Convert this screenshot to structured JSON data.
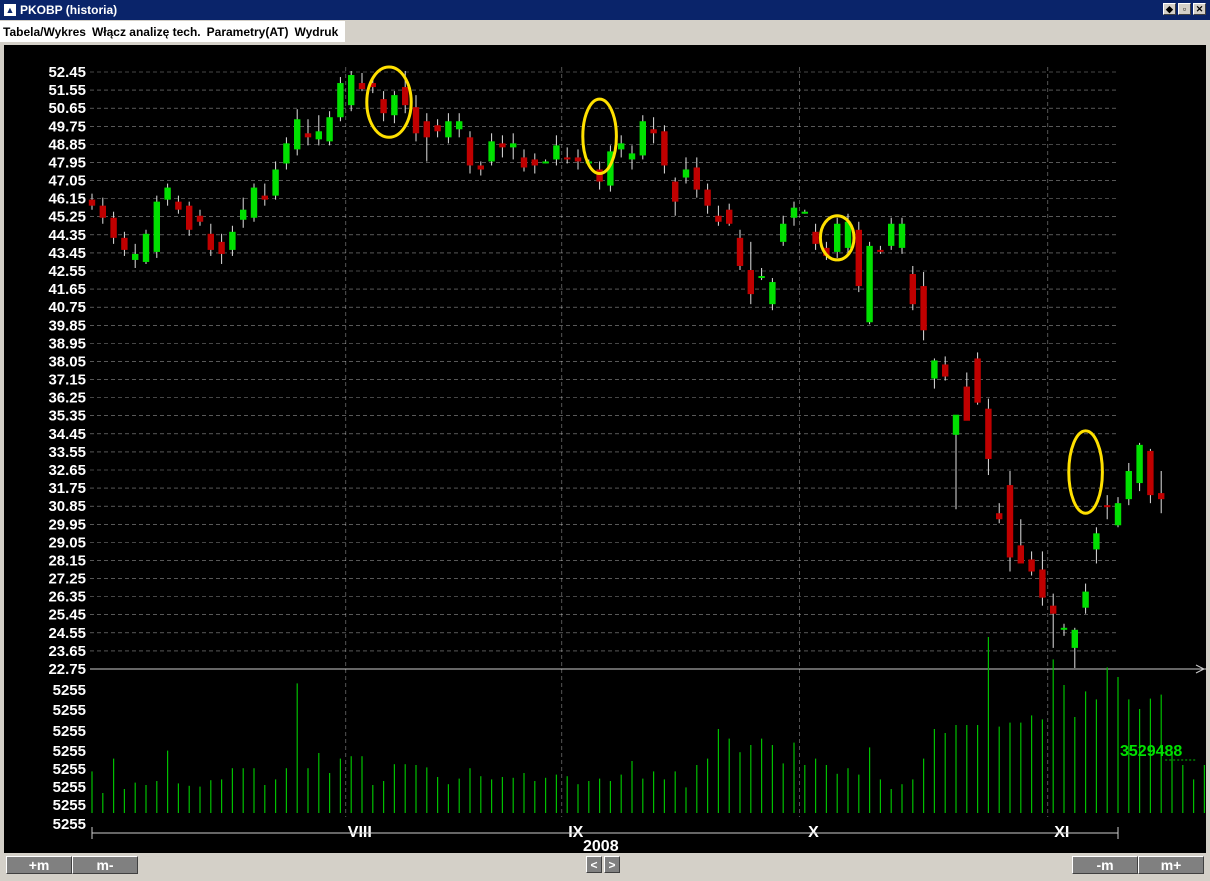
{
  "window": {
    "title": "PKOBP (historia)"
  },
  "menu": {
    "items": [
      "Tabela/Wykres",
      "Włącz analizę tech.",
      "Parametry(AT)",
      "Wydruk"
    ]
  },
  "toolbar": {
    "zoom_in": "+m",
    "zoom_out": "m-",
    "zoom_out_right": "-m",
    "zoom_in_right": "m+",
    "prev": "<",
    "next": ">"
  },
  "colors": {
    "up": "#00e000",
    "down": "#c00000",
    "annotation": "#ffe000",
    "volume": "#00c000",
    "grid": "#ffffff",
    "background": "#000000"
  },
  "chart_data": {
    "type": "candlestick",
    "year_label": "2008",
    "month_labels": [
      {
        "label": "VIII",
        "index": 24
      },
      {
        "label": "IX",
        "index": 44
      },
      {
        "label": "X",
        "index": 66
      },
      {
        "label": "XI",
        "index": 89
      }
    ],
    "price_ticks": [
      "52.45",
      "51.55",
      "50.65",
      "49.75",
      "48.85",
      "47.95",
      "47.05",
      "46.15",
      "45.25",
      "44.35",
      "43.45",
      "42.55",
      "41.65",
      "40.75",
      "39.85",
      "38.95",
      "38.05",
      "37.15",
      "36.25",
      "35.35",
      "34.45",
      "33.55",
      "32.65",
      "31.75",
      "30.85",
      "29.95",
      "29.05",
      "28.15",
      "27.25",
      "26.35",
      "25.45",
      "24.55",
      "23.65",
      "22.75"
    ],
    "ylim": [
      22.75,
      52.45
    ],
    "volume_ticks": [
      "5255",
      "5255",
      "5255",
      "5255",
      "5255",
      "5255",
      "5255",
      "5255"
    ],
    "last_volume": "3529488",
    "candles": [
      [
        46.1,
        46.4,
        45.6,
        45.8
      ],
      [
        45.8,
        46.2,
        44.9,
        45.2
      ],
      [
        45.2,
        45.5,
        43.9,
        44.2
      ],
      [
        44.2,
        44.5,
        43.3,
        43.6
      ],
      [
        43.1,
        43.9,
        42.7,
        43.4
      ],
      [
        43.0,
        44.6,
        42.9,
        44.4
      ],
      [
        43.5,
        46.3,
        43.2,
        46.0
      ],
      [
        46.1,
        46.9,
        45.8,
        46.7
      ],
      [
        46.0,
        46.3,
        45.4,
        45.6
      ],
      [
        45.8,
        46.0,
        44.3,
        44.6
      ],
      [
        45.3,
        45.6,
        44.8,
        45.0
      ],
      [
        44.4,
        44.9,
        43.3,
        43.6
      ],
      [
        44.0,
        44.4,
        42.9,
        43.4
      ],
      [
        43.6,
        44.8,
        43.3,
        44.5
      ],
      [
        45.1,
        46.2,
        44.7,
        45.6
      ],
      [
        45.2,
        46.9,
        45.0,
        46.7
      ],
      [
        46.3,
        46.9,
        45.8,
        46.1
      ],
      [
        46.3,
        48.0,
        46.1,
        47.6
      ],
      [
        47.9,
        49.2,
        47.6,
        48.9
      ],
      [
        48.6,
        50.6,
        48.3,
        50.1
      ],
      [
        49.4,
        50.1,
        48.8,
        49.2
      ],
      [
        49.1,
        50.3,
        48.8,
        49.5
      ],
      [
        49.0,
        50.5,
        48.8,
        50.2
      ],
      [
        50.2,
        52.2,
        50.0,
        51.9
      ],
      [
        50.8,
        52.5,
        50.5,
        52.3
      ],
      [
        51.9,
        52.4,
        51.5,
        51.6
      ],
      [
        51.9,
        52.1,
        51.4,
        51.7
      ],
      [
        51.1,
        51.5,
        50.0,
        50.4
      ],
      [
        50.3,
        51.5,
        49.9,
        51.3
      ],
      [
        51.7,
        52.5,
        50.4,
        50.8
      ],
      [
        50.7,
        51.3,
        49.0,
        49.4
      ],
      [
        50.0,
        50.4,
        48.0,
        49.2
      ],
      [
        49.8,
        50.1,
        49.2,
        49.5
      ],
      [
        49.2,
        50.4,
        48.9,
        50.0
      ],
      [
        49.6,
        50.4,
        49.2,
        50.0
      ],
      [
        49.2,
        49.5,
        47.4,
        47.8
      ],
      [
        47.8,
        48.0,
        47.3,
        47.6
      ],
      [
        48.0,
        49.4,
        47.8,
        49.0
      ],
      [
        48.9,
        49.3,
        48.2,
        48.7
      ],
      [
        48.7,
        49.4,
        48.1,
        48.9
      ],
      [
        48.2,
        48.6,
        47.5,
        47.7
      ],
      [
        48.1,
        48.4,
        47.4,
        47.8
      ],
      [
        48.0,
        48.1,
        47.9,
        48.0
      ],
      [
        48.1,
        49.3,
        47.8,
        48.8
      ],
      [
        48.2,
        48.7,
        47.9,
        48.1
      ],
      [
        48.2,
        48.6,
        47.6,
        48.0
      ],
      [
        48.0,
        48.1,
        47.9,
        48.0
      ],
      [
        47.6,
        48.0,
        46.6,
        47.0
      ],
      [
        46.8,
        48.8,
        46.5,
        48.5
      ],
      [
        48.6,
        49.3,
        48.2,
        48.9
      ],
      [
        48.1,
        48.8,
        47.6,
        48.4
      ],
      [
        48.3,
        50.3,
        48.1,
        50.0
      ],
      [
        49.6,
        50.2,
        48.9,
        49.4
      ],
      [
        49.5,
        49.8,
        47.4,
        47.8
      ],
      [
        47.0,
        47.2,
        45.3,
        46.0
      ],
      [
        47.2,
        48.2,
        46.9,
        47.6
      ],
      [
        47.7,
        48.2,
        46.2,
        46.6
      ],
      [
        46.6,
        46.9,
        45.4,
        45.8
      ],
      [
        45.3,
        45.8,
        44.8,
        45.0
      ],
      [
        45.6,
        45.9,
        44.8,
        44.9
      ],
      [
        44.2,
        44.6,
        42.6,
        42.8
      ],
      [
        42.6,
        44.0,
        40.9,
        41.4
      ],
      [
        42.3,
        42.7,
        42.1,
        42.3
      ],
      [
        40.9,
        42.2,
        40.6,
        42.0
      ],
      [
        44.0,
        45.3,
        43.8,
        44.9
      ],
      [
        45.2,
        46.0,
        44.8,
        45.7
      ],
      [
        45.5,
        45.6,
        45.4,
        45.5
      ],
      [
        44.5,
        44.9,
        43.6,
        43.9
      ],
      [
        43.7,
        44.0,
        43.1,
        43.3
      ],
      [
        43.5,
        45.2,
        43.2,
        44.9
      ],
      [
        43.7,
        45.4,
        43.4,
        45.0
      ],
      [
        44.6,
        45.0,
        41.5,
        41.8
      ],
      [
        40.0,
        44.0,
        39.9,
        43.8
      ],
      [
        43.6,
        43.8,
        43.4,
        43.5
      ],
      [
        43.8,
        45.2,
        43.6,
        44.9
      ],
      [
        43.7,
        45.2,
        43.4,
        44.9
      ],
      [
        42.4,
        42.8,
        40.6,
        40.9
      ],
      [
        41.8,
        42.5,
        39.1,
        39.6
      ],
      [
        37.2,
        38.2,
        36.7,
        38.1
      ],
      [
        37.9,
        38.3,
        37.1,
        37.3
      ],
      [
        34.4,
        35.2,
        30.7,
        35.4
      ],
      [
        36.8,
        37.5,
        35.2,
        35.1
      ],
      [
        38.2,
        38.5,
        35.9,
        36.0
      ],
      [
        35.7,
        36.2,
        32.4,
        33.2
      ],
      [
        30.5,
        31.0,
        30.0,
        30.2
      ],
      [
        31.9,
        32.6,
        27.6,
        28.3
      ],
      [
        28.9,
        30.2,
        28.1,
        28.0
      ],
      [
        28.2,
        28.6,
        27.4,
        27.6
      ],
      [
        27.7,
        28.6,
        25.9,
        26.3
      ],
      [
        25.9,
        26.5,
        23.8,
        25.5
      ],
      [
        24.8,
        25.0,
        24.4,
        24.8
      ],
      [
        23.8,
        24.8,
        22.8,
        24.7
      ],
      [
        25.8,
        27.0,
        25.5,
        26.6
      ],
      [
        28.7,
        29.8,
        28.0,
        29.5
      ],
      [
        30.9,
        31.4,
        30.2,
        30.8
      ],
      [
        29.9,
        31.3,
        29.8,
        31.0
      ],
      [
        31.2,
        33.0,
        30.9,
        32.6
      ],
      [
        32.0,
        34.0,
        31.6,
        33.9
      ],
      [
        33.6,
        33.7,
        31.0,
        31.4
      ],
      [
        31.5,
        32.6,
        30.5,
        31.2
      ]
    ],
    "volumes": [
      0.52,
      0.25,
      0.68,
      0.3,
      0.38,
      0.35,
      0.4,
      0.78,
      0.37,
      0.34,
      0.33,
      0.41,
      0.42,
      0.56,
      0.56,
      0.56,
      0.35,
      0.42,
      0.56,
      1.62,
      0.56,
      0.75,
      0.5,
      0.68,
      0.71,
      0.71,
      0.35,
      0.4,
      0.61,
      0.61,
      0.6,
      0.57,
      0.45,
      0.36,
      0.43,
      0.56,
      0.46,
      0.42,
      0.45,
      0.44,
      0.5,
      0.4,
      0.44,
      0.48,
      0.46,
      0.36,
      0.4,
      0.43,
      0.4,
      0.48,
      0.65,
      0.43,
      0.52,
      0.42,
      0.52,
      0.32,
      0.6,
      0.68,
      1.05,
      0.93,
      0.76,
      0.85,
      0.93,
      0.85,
      0.62,
      0.88,
      0.6,
      0.68,
      0.6,
      0.49,
      0.56,
      0.48,
      0.82,
      0.42,
      0.3,
      0.36,
      0.42,
      0.68,
      1.05,
      1.0,
      1.1,
      1.1,
      1.1,
      2.2,
      1.08,
      1.13,
      1.13,
      1.22,
      1.17,
      1.92,
      1.6,
      1.2,
      1.52,
      1.42,
      1.82,
      1.7,
      1.42,
      1.3,
      1.43,
      1.48,
      0.78,
      0.6,
      0.42,
      0.6
    ]
  }
}
